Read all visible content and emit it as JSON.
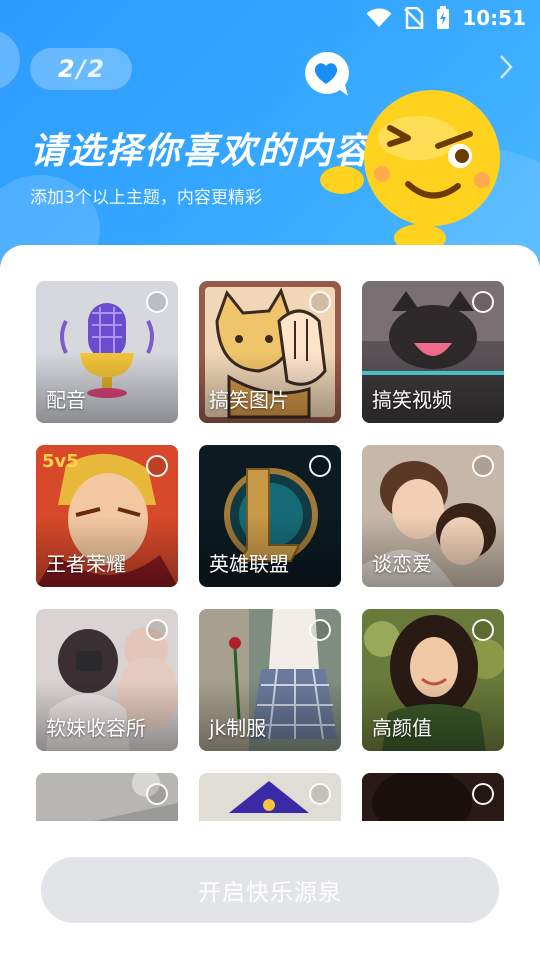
{
  "status_bar": {
    "time": "10:51",
    "icons": [
      "wifi-icon",
      "no-sim-icon",
      "battery-charging-icon"
    ]
  },
  "pager": {
    "current": "2",
    "separator": "/",
    "total": "2"
  },
  "header": {
    "title": "请选择你喜欢的内容",
    "subtitle": "添加3个以上主题，内容更精彩"
  },
  "topics": [
    {
      "label": "配音",
      "icon": "microphone-art"
    },
    {
      "label": "搞笑图片",
      "icon": "cartoon-cat-art"
    },
    {
      "label": "搞笑视频",
      "icon": "cat-photo"
    },
    {
      "label": "王者荣耀",
      "icon": "game-hero-art"
    },
    {
      "label": "英雄联盟",
      "icon": "league-logo"
    },
    {
      "label": "谈恋爱",
      "icon": "couple-photo"
    },
    {
      "label": "软妹收容所",
      "icon": "girl-teddy-photo"
    },
    {
      "label": "jk制服",
      "icon": "uniform-photo"
    },
    {
      "label": "高颜值",
      "icon": "portrait-photo"
    }
  ],
  "cta": {
    "label": "开启快乐源泉"
  },
  "colors": {
    "hero_blue": "#2e9bff",
    "cta_disabled": "#e3e4e8",
    "mascot_yellow": "#ffd21f"
  }
}
